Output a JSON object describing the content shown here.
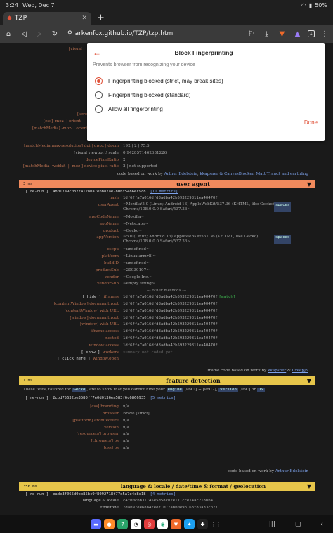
{
  "status": {
    "time": "3:24",
    "date": "Wed, Dec 7",
    "battery": "50%"
  },
  "tab": {
    "title": "TZP"
  },
  "toolbar": {
    "url": "arkenfox.github.io/TZP/tzp.html",
    "tab_count": "1"
  },
  "screen_rows": [
    {
      "k": "[matchMedia max-resolution] dpi | dppx | dpcm",
      "v": "192 | 2 | 75.5"
    },
    {
      "k": "[visual viewport] scale",
      "v": "0.9428571462631226"
    },
    {
      "k": "devicePixelRatio",
      "v": "2"
    },
    {
      "k": "[matchMedia -webkit- | -moz-] device-pixel-ratio",
      "v": "2 | not supported"
    }
  ],
  "screen_left": {
    "a": "[visual",
    "b": "[scre",
    "c": "[css] -moz- | orient",
    "d": "[matchMedia] -moz- | orient"
  },
  "credit1": {
    "text": "code based on work by",
    "a": "Arthur Edelstein",
    "b": "kkapsner & CanvasBlocker",
    "c": "Matt Traudt",
    "d": "and earthling"
  },
  "ua": {
    "ms": "3 ms",
    "title": "user agent",
    "rerun": "[ re-run ]",
    "hash": "48017a9c082f41280a7ebb87ae780bf5486ec9c8",
    "metrics": "[11 metrics]",
    "rows": [
      {
        "k": "hash",
        "v": "1df6ffa7a016dfd8adba42b593229811ea40470f"
      },
      {
        "k": "userAgent",
        "v": "~Mozilla/5.0 (Linux; Android 13) AppleWebKit/537.36 (KHTML, like Gecko) Chrome/108.0.0.0 Safari/537.36~",
        "badge": "spaces"
      },
      {
        "k": "appCodeName",
        "v": "~Mozilla~"
      },
      {
        "k": "appName",
        "v": "~Netscape~"
      },
      {
        "k": "product",
        "v": "~Gecko~"
      },
      {
        "k": "appVersion",
        "v": "~5.0 (Linux; Android 13) AppleWebKit/537.36 (KHTML, like Gecko) Chrome/108.0.0.0 Safari/537.36~",
        "badge": "spaces"
      },
      {
        "k": "oscpu",
        "v": "~undefined~"
      },
      {
        "k": "platform",
        "v": "~Linux armv8l~"
      },
      {
        "k": "buildID",
        "v": "~undefined~"
      },
      {
        "k": "productSub",
        "v": "~20030107~"
      },
      {
        "k": "vendor",
        "v": "~Google Inc.~"
      },
      {
        "k": "vendorSub",
        "v": "~empty string~"
      }
    ],
    "other": "--- other methods ---",
    "hide": "[ hide ]",
    "iframes": "iframes",
    "iframes_v": "1df6ffa7a016dfd8adba42b593229811ea40470f",
    "match": "[match]",
    "methods": [
      {
        "k": "[contentWindow] document root",
        "v": "1df6ffa7a016dfd8adba42b593229811ea40470f"
      },
      {
        "k": "[contentWindow] with URL",
        "v": "1df6ffa7a016dfd8adba42b593229811ea40470f"
      },
      {
        "k": "[window] document root",
        "v": "1df6ffa7a016dfd8adba42b593229811ea40470f"
      },
      {
        "k": "[window] with URL",
        "v": "1df6ffa7a016dfd8adba42b593229811ea40470f"
      },
      {
        "k": "iframe access",
        "v": "1df6ffa7a016dfd8adba42b593229811ea40470f"
      },
      {
        "k": "nested",
        "v": "1df6ffa7a016dfd8adba42b593229811ea40470f"
      },
      {
        "k": "window access",
        "v": "1df6ffa7a016dfd8adba42b593229811ea40470f"
      }
    ],
    "show": "[ show ]",
    "workers": "workers",
    "workers_v": "summary not coded yet",
    "click": "[ click here ]",
    "open": "window.open",
    "credit": "iframe code based on work by",
    "credit_a": "kkapsner",
    "credit_b": "CreepJS"
  },
  "fd": {
    "ms": "1 ms",
    "title": "feature detection",
    "desc1": "These tests, tailored for",
    "gecko": "Gecko",
    "desc2": ", are to show that you cannot hide your",
    "engine": "engine",
    "desc3": "[PoCI] + [PoC2],",
    "version": "version",
    "desc4": "[PoC] or",
    "os": "OS",
    "rerun": "[ re-run ]",
    "hash": "2cbd75632be3580ff7e0d0136ea583f6c6866935",
    "metrics": "[5 metrics]",
    "rows": [
      {
        "k": "[css] branding",
        "v": "n/a"
      },
      {
        "k": "browser",
        "v": "Brave [strict]"
      },
      {
        "k": "[platform] architecture",
        "v": "n/a"
      },
      {
        "k": "version",
        "v": "n/a"
      },
      {
        "k": "[resource://] browser",
        "v": "n/a"
      },
      {
        "k": "[chrome://] os",
        "v": "n/a"
      },
      {
        "k": "[css] os",
        "v": "n/a"
      }
    ],
    "credit": "code based on work by",
    "credit_a": "Arthur Edelstein"
  },
  "lang": {
    "ms": "356 ms",
    "title": "language & locale / date/time & format / geolocation",
    "rerun": "[ re-run ]",
    "hash": "eade3f065d0eb85bc9f8092718f77d5a7e4c8c18",
    "metrics": "[4 metrics]",
    "rows": [
      {
        "k": "language & locale",
        "v": "c4f00cbb31745e5d58cb2e171cce14ac218bb4"
      },
      {
        "k": "timezone",
        "v": "7dab97ee6884feef1077abb0e9b168f83a33cb77"
      }
    ]
  },
  "modal": {
    "title": "Block Fingerprinting",
    "subtitle": "Prevents browser from recognizing your device",
    "options": [
      "Fingerprinting blocked (strict, may break sites)",
      "Fingerprinting blocked (standard)",
      "Allow all fingerprinting"
    ],
    "done": "Done"
  }
}
